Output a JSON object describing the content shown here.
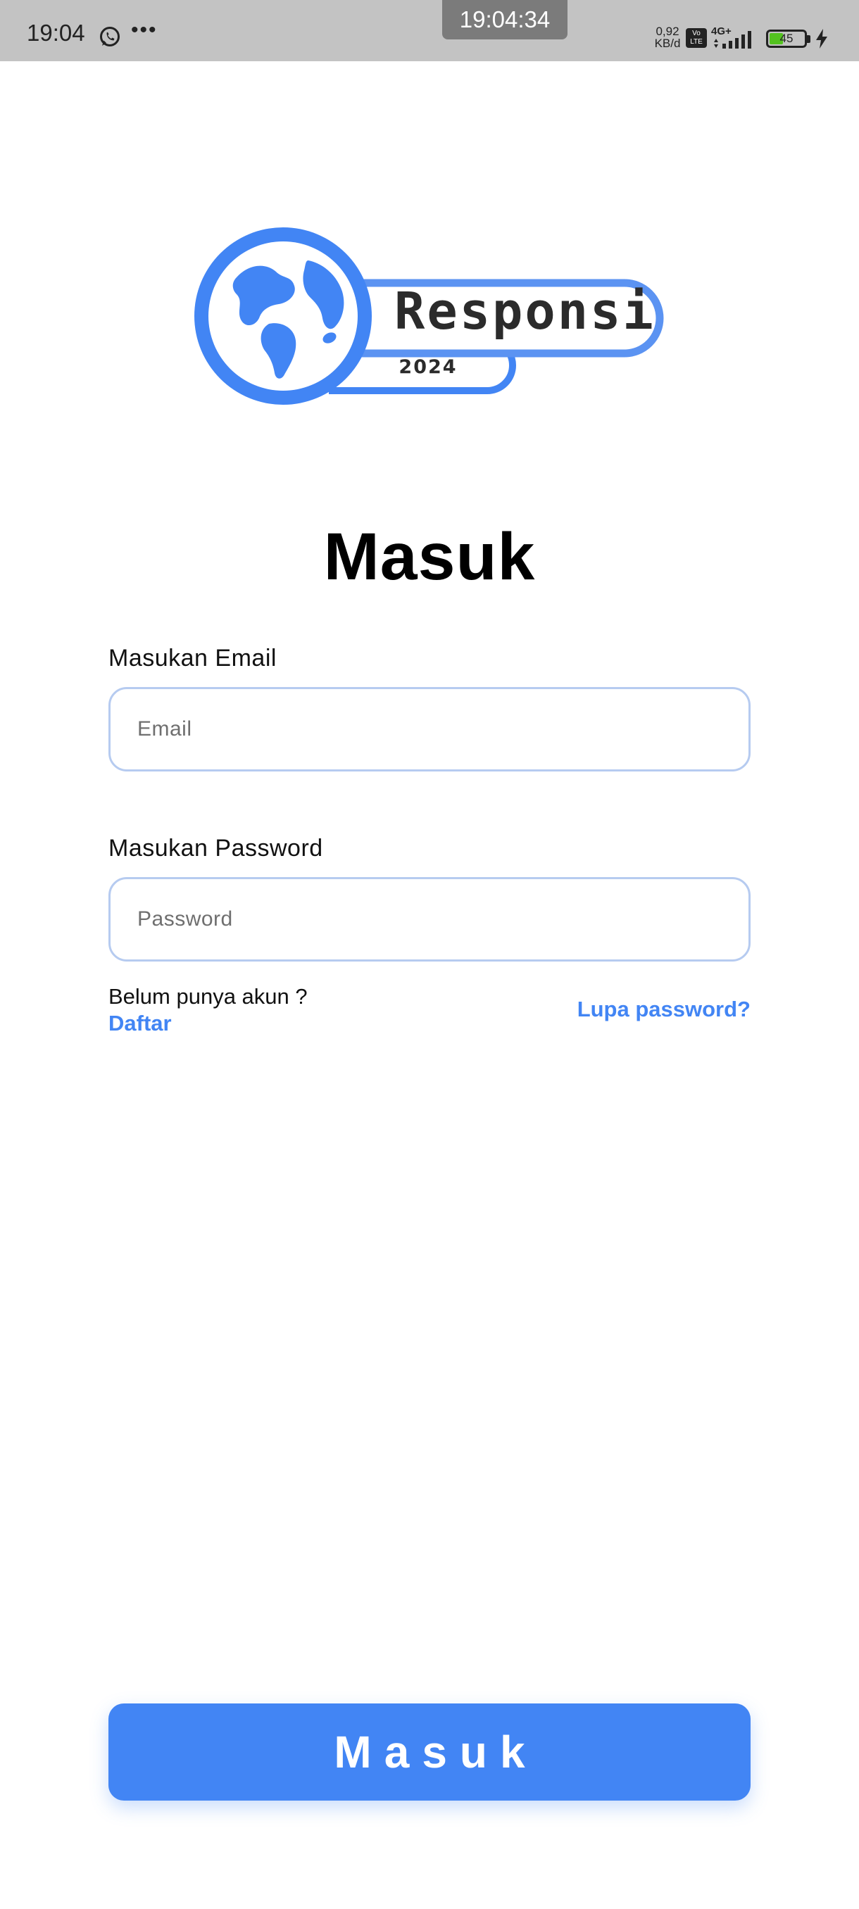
{
  "status_bar": {
    "time": "19:04",
    "notification_more": "•••",
    "screenshot_clock": "19:04:34",
    "network_speed_value": "0,92",
    "network_speed_unit": "KB/d",
    "volte_line1": "Vo",
    "volte_line2": "LTE",
    "network_type": "4G+",
    "battery_percent": "45",
    "battery_level": 0.45,
    "battery_color": "#53c21f",
    "icons": [
      "whatsapp-icon",
      "signal-icon",
      "battery-icon",
      "charging-icon"
    ]
  },
  "logo": {
    "wordmark": "Responsi",
    "year": "2024",
    "accent_color": "#4285f4"
  },
  "title": "Masuk",
  "form": {
    "email_label": "Masukan Email",
    "email_placeholder": "Email",
    "email_value": "",
    "password_label": "Masukan Password",
    "password_placeholder": "Password",
    "password_value": ""
  },
  "links": {
    "no_account_text": "Belum punya akun ?",
    "register_label": "Daftar",
    "forgot_password_label": "Lupa password?"
  },
  "submit": {
    "label": "Masuk",
    "color": "#4285f4"
  }
}
